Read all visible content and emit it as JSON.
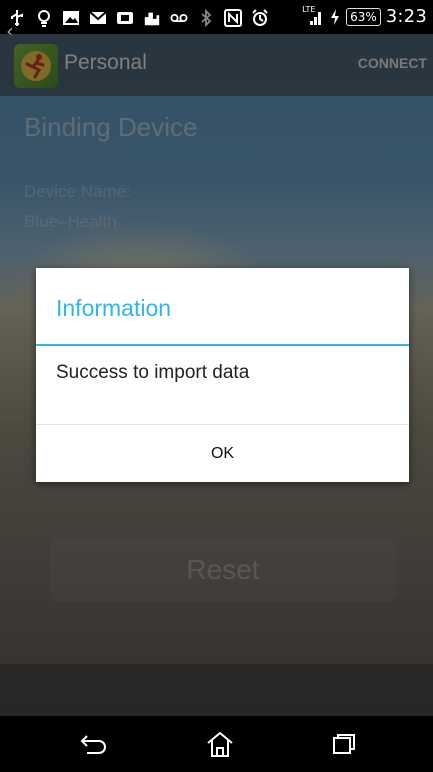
{
  "status_bar": {
    "icons": [
      "usb-icon",
      "bulb-icon",
      "image-icon",
      "gmail-icon",
      "notification-icon",
      "building-icon",
      "voicemail-icon",
      "bluetooth-icon",
      "nfc-icon",
      "alarm-icon",
      "lte-signal-icon",
      "charging-icon"
    ],
    "network": "LTE",
    "battery": "63%",
    "time": "3:23"
  },
  "action_bar": {
    "title": "Personal",
    "connect_label": "CONNECT"
  },
  "page": {
    "heading": "Binding Device",
    "device_name_label": "Device Name:",
    "device_name_value": "Blue–Health",
    "reset_label": "Reset"
  },
  "dialog": {
    "title": "Information",
    "message": "Success to import data",
    "ok_label": "OK",
    "accent_color": "#33b5e5"
  },
  "nav_bar": {
    "icons": [
      "back-icon",
      "home-icon",
      "recents-icon"
    ]
  }
}
